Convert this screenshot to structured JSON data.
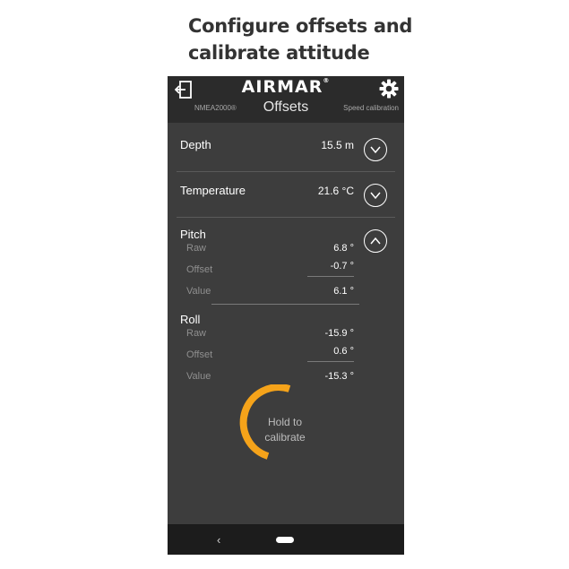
{
  "caption": {
    "line1": "Configure offsets and",
    "line2": "calibrate attitude"
  },
  "header": {
    "logo": "AIRMAR",
    "logo_mark": "®",
    "left_tab": "NMEA2000®",
    "title": "Offsets",
    "right_tab": "Speed calibration"
  },
  "depth": {
    "label": "Depth",
    "value": "15.5 m"
  },
  "temperature": {
    "label": "Temperature",
    "value": "21.6 °C"
  },
  "pitch": {
    "label": "Pitch",
    "raw_label": "Raw",
    "raw_value": "6.8 °",
    "offset_label": "Offset",
    "offset_value": "-0.7 °",
    "value_label": "Value",
    "value_value": "6.1 °"
  },
  "roll": {
    "label": "Roll",
    "raw_label": "Raw",
    "raw_value": "-15.9 °",
    "offset_label": "Offset",
    "offset_value": "0.6 °",
    "value_label": "Value",
    "value_value": "-15.3 °"
  },
  "calibrate": {
    "line1": "Hold to",
    "line2": "calibrate",
    "accent": "#f5a31a"
  },
  "navbar": {
    "back": "‹"
  }
}
